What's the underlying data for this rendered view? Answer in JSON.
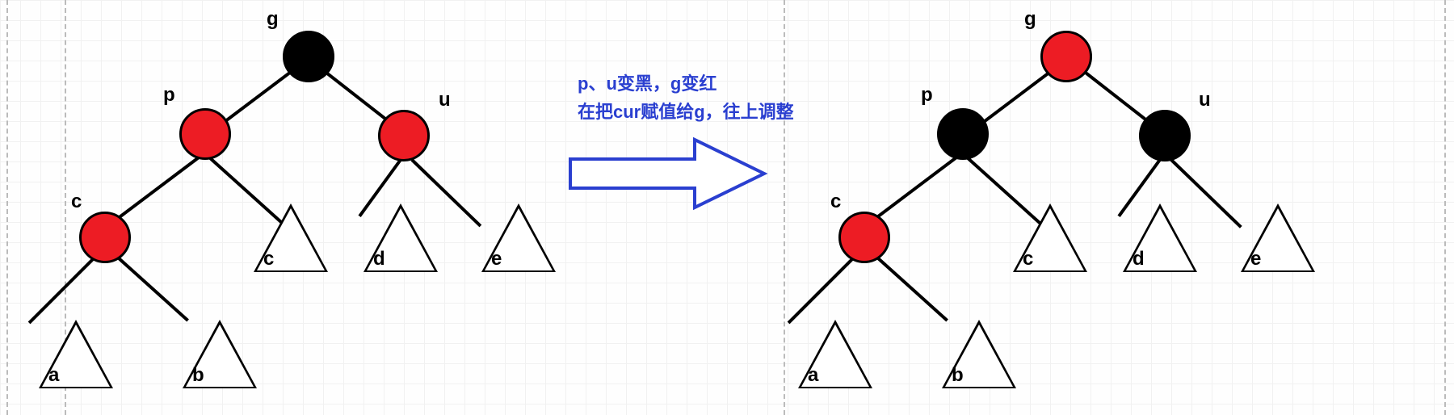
{
  "annotation": {
    "line1": "p、u变黑，g变红",
    "line2": "在把cur赋值给g，往上调整"
  },
  "trees": {
    "left": {
      "nodes": {
        "g": {
          "label": "g",
          "color": "black"
        },
        "p": {
          "label": "p",
          "color": "red"
        },
        "u": {
          "label": "u",
          "color": "red"
        },
        "c": {
          "label": "c",
          "color": "red"
        }
      },
      "subtrees": {
        "a": {
          "label": "a"
        },
        "b": {
          "label": "b"
        },
        "c": {
          "label": "c"
        },
        "d": {
          "label": "d"
        },
        "e": {
          "label": "e"
        }
      }
    },
    "right": {
      "nodes": {
        "g": {
          "label": "g",
          "color": "red"
        },
        "p": {
          "label": "p",
          "color": "black"
        },
        "u": {
          "label": "u",
          "color": "black"
        },
        "c": {
          "label": "c",
          "color": "red"
        }
      },
      "subtrees": {
        "a": {
          "label": "a"
        },
        "b": {
          "label": "b"
        },
        "c": {
          "label": "c"
        },
        "d": {
          "label": "d"
        },
        "e": {
          "label": "e"
        }
      }
    }
  }
}
